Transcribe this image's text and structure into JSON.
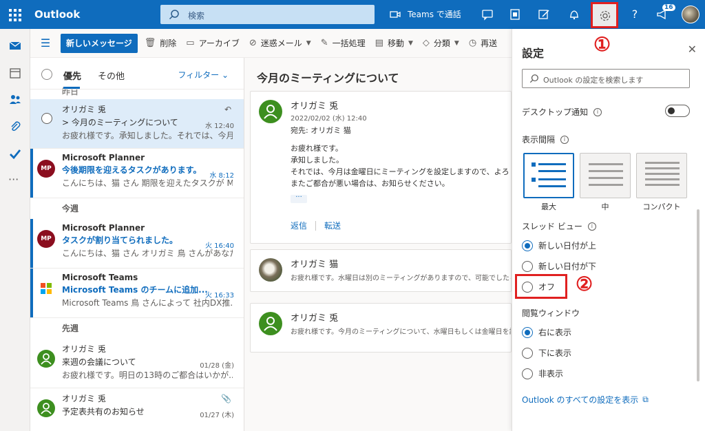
{
  "app": {
    "name": "Outlook"
  },
  "topbar": {
    "search_placeholder": "検索",
    "teams_label": "Teams で通話",
    "notification_count": "16"
  },
  "commands": {
    "new_message": "新しいメッセージ",
    "delete": "削除",
    "archive": "アーカイブ",
    "junk": "迷惑メール",
    "sweep": "一括処理",
    "move": "移動",
    "categorize": "分類",
    "snooze": "再送"
  },
  "list": {
    "tab_focused": "優先",
    "tab_other": "その他",
    "filter": "フィルター",
    "group_yesterday": "昨日",
    "group_this_week": "今週",
    "group_last_week": "先週",
    "items": [
      {
        "from": "オリガミ 兎",
        "subject": "> 今月のミーティングについて",
        "preview": "お疲れ様です。承知しました。それでは、今月...",
        "time": "水 12:40"
      },
      {
        "avatar": "MP",
        "from": "Microsoft Planner",
        "subject": "今後期限を迎えるタスクがあります。",
        "preview": "こんにちは、猫 さん 期限を迎えたタスクが Mic...",
        "time": "水 8:12"
      },
      {
        "avatar": "MP",
        "from": "Microsoft Planner",
        "subject": "タスクが割り当てられました。",
        "preview": "こんにちは、猫 さん オリガミ 鳥 さんがあなたに...",
        "time": "火 16:40"
      },
      {
        "from": "Microsoft Teams",
        "subject": "Microsoft Teams のチームに追加...",
        "preview": "Microsoft Teams 鳥 さんによって 社内DX推...",
        "time": "火 16:33"
      },
      {
        "from": "オリガミ 兎",
        "subject": "来週の会議について",
        "preview": "お疲れ様です。明日の13時のご都合はいかが...",
        "time": "01/28 (金)"
      },
      {
        "from": "オリガミ 兎",
        "subject": "予定表共有のお知らせ",
        "preview": "",
        "time": "01/27 (木)"
      }
    ]
  },
  "reader": {
    "title": "今月のミーティングについて",
    "message1": {
      "from": "オリガミ 兎",
      "date": "2022/02/02 (水) 12:40",
      "to": "宛先: オリガミ 猫",
      "body_line1": "お疲れ様です。",
      "body_line2": "承知しました。",
      "body_line3": "それでは、今月は金曜日にミーティングを設定しますので、よろし",
      "body_line4": "またご都合が悪い場合は、お知らせください。",
      "more": "···",
      "reply": "返信",
      "forward": "転送"
    },
    "message2": {
      "from": "オリガミ 猫",
      "snippet": "お疲れ様です。水曜日は別のミーティングがありますので、可能でしたら金曜日"
    },
    "message3": {
      "from": "オリガミ 兎",
      "snippet": "お疲れ様です。今月のミーティングについて、水曜日もしくは金曜日を設定する"
    }
  },
  "settings": {
    "title": "設定",
    "search_placeholder": "Outlook の設定を検索します",
    "desktop_notifications": "デスクトップ通知",
    "density_label": "表示間隔",
    "density_options": [
      "最大",
      "中",
      "コンパクト"
    ],
    "thread_label": "スレッド ビュー",
    "thread_options": [
      "新しい日付が上",
      "新しい日付が下",
      "オフ"
    ],
    "reading_label": "閲覧ウィンドウ",
    "reading_options": [
      "右に表示",
      "下に表示",
      "非表示"
    ],
    "all_settings": "Outlook のすべての設定を表示"
  },
  "annotations": {
    "marker1": "①",
    "marker2": "②"
  },
  "colors": {
    "accent": "#0f6cbd",
    "highlight": "#e02020"
  }
}
